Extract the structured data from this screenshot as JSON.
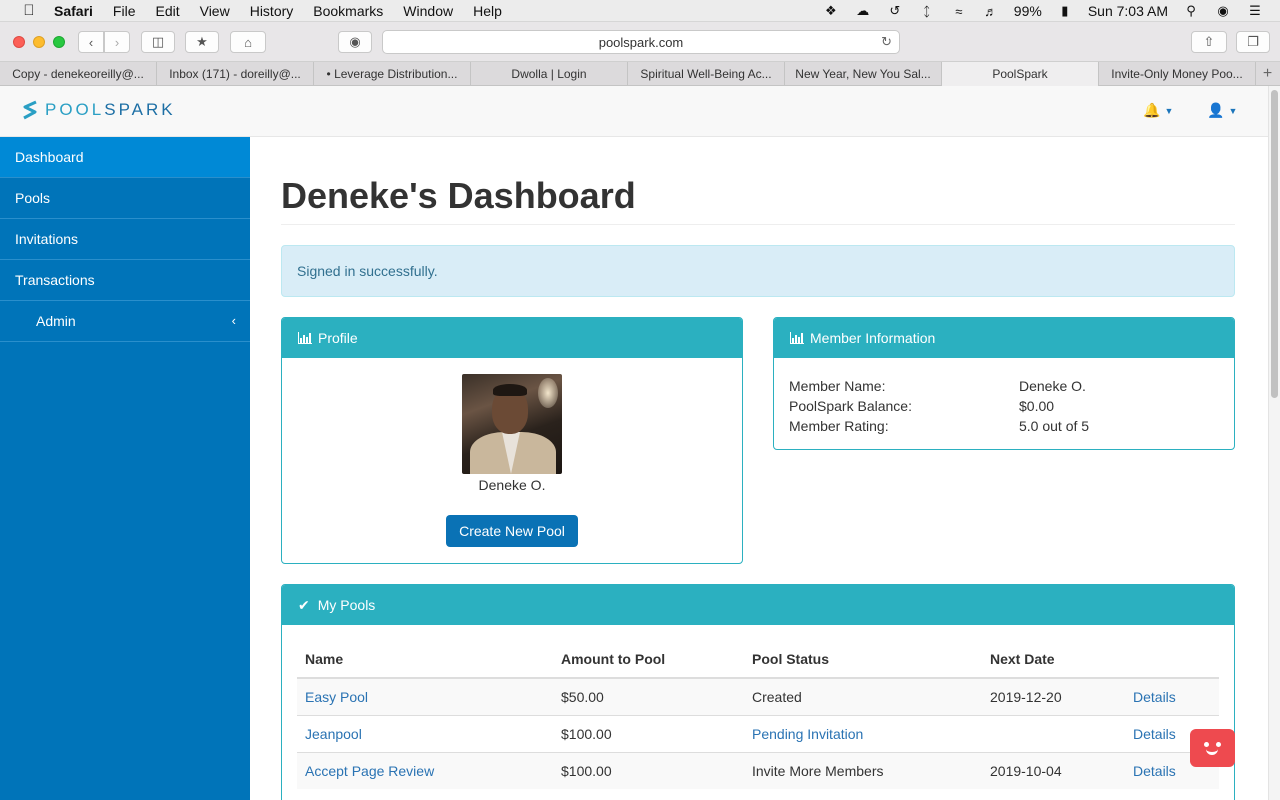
{
  "menubar": {
    "app_name": "Safari",
    "menus": [
      "File",
      "Edit",
      "View",
      "History",
      "Bookmarks",
      "Window",
      "Help"
    ],
    "battery": "99%",
    "clock": "Sun 7:03 AM"
  },
  "browser": {
    "url": "poolspark.com",
    "tabs": [
      {
        "label": "Copy - denekeoreilly@..."
      },
      {
        "label": "Inbox (171) - doreilly@..."
      },
      {
        "label": "• Leverage Distribution..."
      },
      {
        "label": "Dwolla | Login"
      },
      {
        "label": "Spiritual Well-Being Ac..."
      },
      {
        "label": "New Year, New You Sal..."
      },
      {
        "label": "PoolSpark"
      },
      {
        "label": "Invite-Only Money Poo..."
      }
    ],
    "active_tab": 6
  },
  "site": {
    "logo_pre": "POOL",
    "logo_post": "SPARK",
    "brand_color": "#0074b9",
    "accent_color": "#2bb0c0"
  },
  "sidebar": {
    "items": [
      {
        "label": "Dashboard",
        "active": true
      },
      {
        "label": "Pools"
      },
      {
        "label": "Invitations"
      },
      {
        "label": "Transactions"
      },
      {
        "label": "Admin"
      }
    ]
  },
  "main": {
    "title": "Deneke's Dashboard",
    "alert": "Signed in successfully.",
    "profile": {
      "heading": "Profile",
      "name": "Deneke O.",
      "create_button": "Create New Pool"
    },
    "member_info": {
      "heading": "Member Information",
      "rows": [
        {
          "key": "Member Name:",
          "value": "Deneke O."
        },
        {
          "key": "PoolSpark Balance:",
          "value": "$0.00"
        },
        {
          "key": "Member Rating:",
          "value": "5.0 out of 5"
        }
      ]
    },
    "my_pools": {
      "heading": "My Pools",
      "columns": [
        "Name",
        "Amount to Pool",
        "Pool Status",
        "Next Date"
      ],
      "rows": [
        {
          "name": "Easy Pool",
          "amount": "$50.00",
          "status": "Created",
          "status_link": false,
          "next_date": "2019-12-20",
          "action": "Details"
        },
        {
          "name": "Jeanpool",
          "amount": "$100.00",
          "status": "Pending Invitation",
          "status_link": true,
          "next_date": "",
          "action": "Details"
        },
        {
          "name": "Accept Page Review",
          "amount": "$100.00",
          "status": "Invite More Members",
          "status_link": false,
          "next_date": "2019-10-04",
          "action": "Details"
        }
      ]
    }
  }
}
